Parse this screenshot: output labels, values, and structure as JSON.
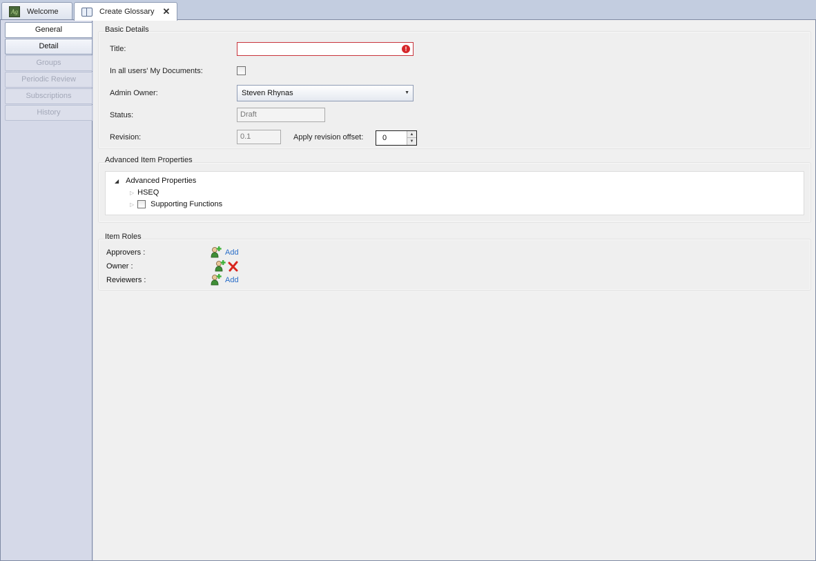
{
  "tabs": [
    {
      "label": "Welcome",
      "icon": "app-logo-icon"
    },
    {
      "label": "Create Glossary",
      "icon": "book-icon",
      "active": true
    }
  ],
  "tab_logo_text": "Ag",
  "sidebar": {
    "items": [
      {
        "label": "General",
        "state": "selected"
      },
      {
        "label": "Detail",
        "state": "normal"
      },
      {
        "label": "Groups",
        "state": "disabled"
      },
      {
        "label": "Periodic Review",
        "state": "disabled"
      },
      {
        "label": "Subscriptions",
        "state": "disabled"
      },
      {
        "label": "History",
        "state": "disabled"
      }
    ]
  },
  "basic_details": {
    "section_title": "Basic Details",
    "title_label": "Title:",
    "title_value": "",
    "title_error": true,
    "my_documents_label": "In all users' My Documents:",
    "my_documents_checked": false,
    "admin_owner_label": "Admin Owner:",
    "admin_owner_value": "Steven Rhynas",
    "status_label": "Status:",
    "status_value": "Draft",
    "revision_label": "Revision:",
    "revision_value": "0.1",
    "revision_offset_label": "Apply revision offset:",
    "revision_offset_value": "0"
  },
  "advanced": {
    "section_title": "Advanced Item Properties",
    "tree": {
      "root": "Advanced Properties",
      "children": [
        {
          "label": "HSEQ",
          "checkbox": false
        },
        {
          "label": "Supporting Functions",
          "checkbox": true,
          "checked": false
        }
      ]
    }
  },
  "roles": {
    "section_title": "Item Roles",
    "approvers_label": "Approvers :",
    "approvers_action": "Add",
    "owner_label": "Owner :",
    "reviewers_label": "Reviewers :",
    "reviewers_action": "Add"
  },
  "colors": {
    "error_border": "#c8333b",
    "link": "#2a6ec8",
    "sidebar_bg": "#d5d9e8"
  }
}
